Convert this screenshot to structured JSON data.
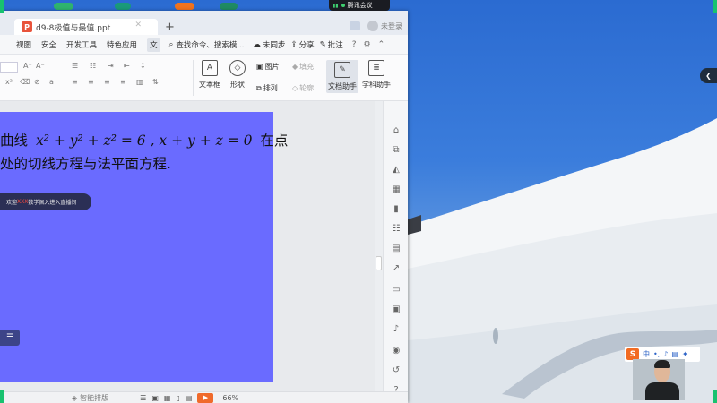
{
  "window": {
    "tab_title": "d9-8极值与最值.ppt",
    "tab_badge": "P",
    "new_tab": "+",
    "user_label": "未登录",
    "page_badge": "1"
  },
  "meeting": {
    "label": "腾讯会议"
  },
  "menu": {
    "items": [
      "视图",
      "安全",
      "开发工具",
      "特色应用"
    ],
    "partial_item": "文",
    "search_label": "查找命令、搜索模...",
    "sync_label": "未同步",
    "share_label": "分享",
    "comment_label": "批注",
    "help": "?"
  },
  "ribbon": {
    "textbox_label": "文本框",
    "shape_label": "形状",
    "picture_label": "图片",
    "fill_label": "填充",
    "arrange_label": "排列",
    "outline_label": "轮廓",
    "doc_assistant_label": "文档助手",
    "subject_assistant_label": "学科助手"
  },
  "slide": {
    "line1_prefix": "曲线",
    "equation": "x² + y² + z² = 6 , x + y + z = 0",
    "line1_suffix": "在点",
    "line2": "处的切线方程与法平面方程.",
    "live_prefix": "欢迎",
    "live_red": "XXX",
    "live_suffix": "数学佩入进入直播间"
  },
  "statusbar": {
    "smart_label": "智能排版",
    "zoom": "66%"
  },
  "ime": {
    "logo": "S",
    "mode": "中"
  },
  "colors": {
    "slide_bg": "#6a6bff",
    "ppt_badge": "#e8533b",
    "play_button": "#f06a2b",
    "ime_logo": "#f26b22",
    "meeting_signal": "#3ecf6f"
  }
}
